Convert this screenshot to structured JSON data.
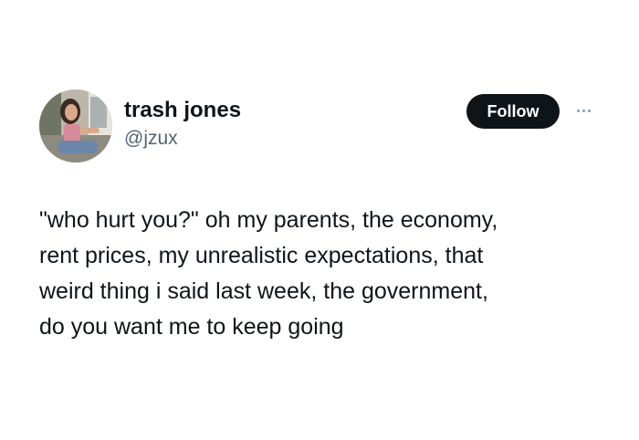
{
  "user": {
    "display_name": "trash jones",
    "handle": "@jzux",
    "avatar_icon": "profile-photo"
  },
  "actions": {
    "follow_label": "Follow",
    "more_icon": "more-dots-icon"
  },
  "tweet": {
    "lines": [
      "\"who hurt you?\" oh my parents, the economy,",
      "rent prices, my unrealistic expectations, that",
      "weird thing i said last week, the government,",
      "do you want me to keep going"
    ]
  },
  "colors": {
    "text": "#0f1419",
    "secondary_text": "#536471",
    "button_bg": "#0f1419",
    "button_text": "#ffffff"
  }
}
